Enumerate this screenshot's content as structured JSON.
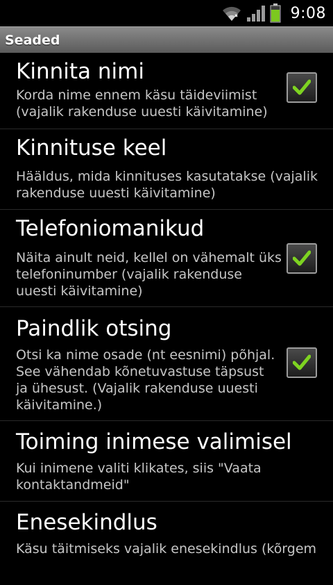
{
  "status_bar": {
    "time": "9:08",
    "icons": [
      "wifi-icon",
      "signal-icon",
      "battery-icon"
    ],
    "battery_color": "#7cc81f"
  },
  "title_bar": {
    "title": "Seaded"
  },
  "colors": {
    "checkmark": "#7ed321",
    "background": "#000000"
  },
  "settings": [
    {
      "title": "Kinnita nimi",
      "summary": "Korda nime ennem käsu täideviimist\n(vajalik rakenduse uuesti käivitamine)",
      "checked": true
    },
    {
      "title": "Kinnituse keel",
      "summary": "Hääldus, mida kinnituses kasutatakse (vajalik\nrakenduse uuesti käivitamine)"
    },
    {
      "title": "Telefoniomanikud",
      "summary": "Näita ainult neid, kellel on vähemalt üks\ntelefoninumber (vajalik rakenduse\nuuesti käivitamine)",
      "checked": true
    },
    {
      "title": "Paindlik otsing",
      "summary": "Otsi ka nime osade (nt eesnimi) põhjal.\nSee vähendab kõnetuvastuse täpsust\nja ühesust. (Vajalik rakenduse uuesti\nkäivitamine.)",
      "checked": true
    },
    {
      "title": "Toiming inimese valimisel",
      "summary": "Kui inimene valiti klikates, siis \"Vaata\nkontaktandmeid\""
    },
    {
      "title": "Enesekindlus",
      "summary": "Käsu täitmiseks vajalik enesekindlus (kõrgem"
    }
  ]
}
